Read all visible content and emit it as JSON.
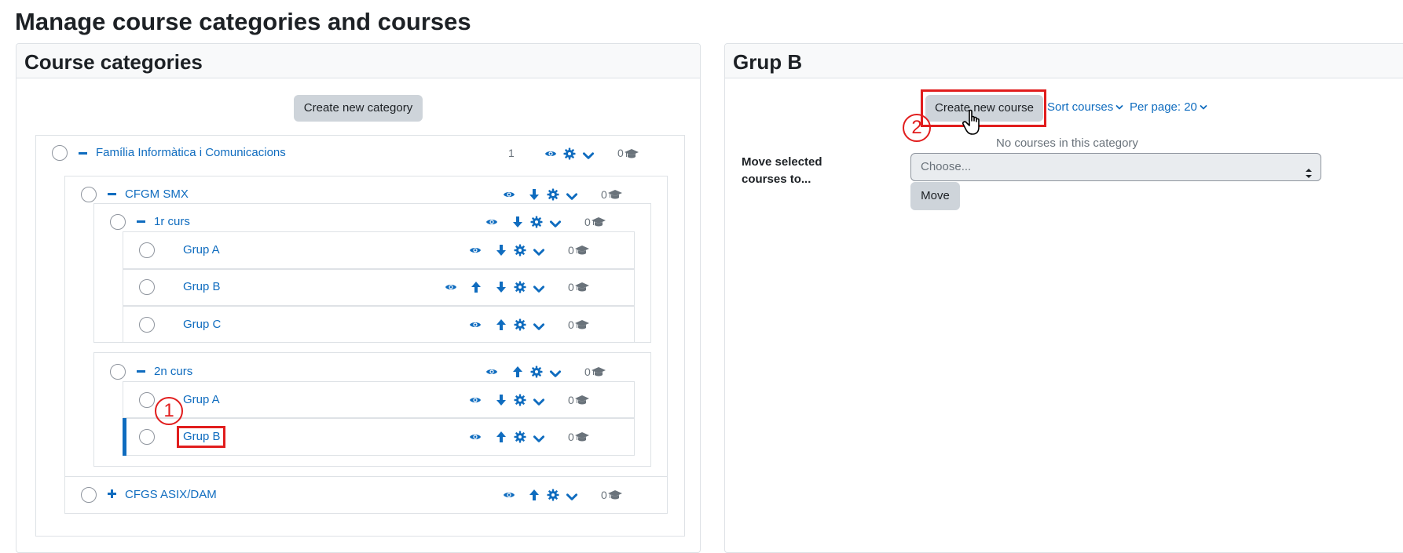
{
  "page": {
    "title": "Manage course categories and courses"
  },
  "left": {
    "title": "Course categories",
    "create_category_label": "Create new category",
    "rows": [
      {
        "name": "Família Informàtica i Comunicacions",
        "count": "1",
        "courses": "0"
      },
      {
        "name": "CFGM SMX",
        "courses": "0"
      },
      {
        "name": "1r curs",
        "courses": "0"
      },
      {
        "name": "Grup A",
        "courses": "0"
      },
      {
        "name": "Grup B",
        "courses": "0"
      },
      {
        "name": "Grup C",
        "courses": "0"
      },
      {
        "name": "2n curs",
        "courses": "0"
      },
      {
        "name": "Grup A",
        "courses": "0"
      },
      {
        "name": "Grup B",
        "courses": "0"
      },
      {
        "name": "CFGS ASIX/DAM",
        "courses": "0"
      }
    ]
  },
  "right": {
    "title": "Grup B",
    "create_course_label": "Create new course",
    "sort_label": "Sort courses",
    "per_page_label": "Per page: 20",
    "empty_text": "No courses in this category",
    "move_label": "Move selected courses to...",
    "move_select_value": "Choose...",
    "move_button_label": "Move"
  },
  "annotations": {
    "step1": "1",
    "step2": "2"
  },
  "colors": {
    "link": "#0f6cbf",
    "annotation": "#e11d1d",
    "button": "#ced4da"
  }
}
